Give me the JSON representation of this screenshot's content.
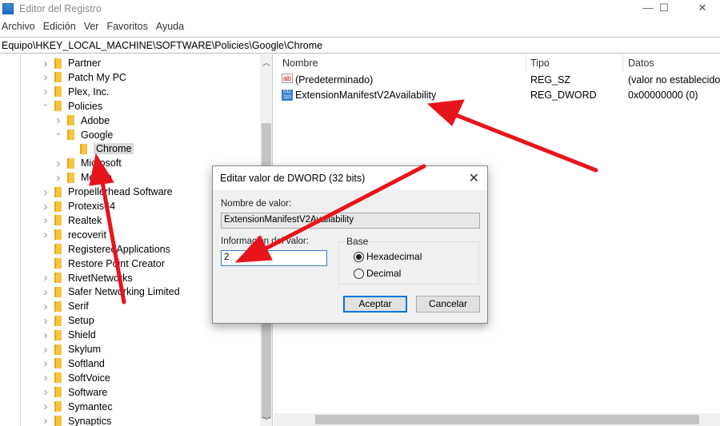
{
  "window": {
    "title": "Editor del Registro",
    "minimize": "—",
    "maximize": "☐",
    "close": "✕"
  },
  "menu": [
    "Archivo",
    "Edición",
    "Ver",
    "Favoritos",
    "Ayuda"
  ],
  "address": "Equipo\\HKEY_LOCAL_MACHINE\\SOFTWARE\\Policies\\Google\\Chrome",
  "tree": [
    {
      "label": "Partner",
      "level": 1,
      "state": "collapsed"
    },
    {
      "label": "Patch My PC",
      "level": 1,
      "state": "collapsed"
    },
    {
      "label": "Plex, Inc.",
      "level": 1,
      "state": "collapsed"
    },
    {
      "label": "Policies",
      "level": 1,
      "state": "expanded"
    },
    {
      "label": "Adobe",
      "level": 2,
      "state": "collapsed"
    },
    {
      "label": "Google",
      "level": 2,
      "state": "expanded"
    },
    {
      "label": "Chrome",
      "level": 3,
      "state": "selected"
    },
    {
      "label": "Microsoft",
      "level": 2,
      "state": "collapsed"
    },
    {
      "label": "Mozilla",
      "level": 2,
      "state": "collapsed"
    },
    {
      "label": "Propellerhead Software",
      "level": 1,
      "state": "collapsed"
    },
    {
      "label": "Protexis64",
      "level": 1,
      "state": "collapsed"
    },
    {
      "label": "Realtek",
      "level": 1,
      "state": "collapsed"
    },
    {
      "label": "recoverit",
      "level": 1,
      "state": "collapsed"
    },
    {
      "label": "RegisteredApplications",
      "level": 1,
      "state": "leaf"
    },
    {
      "label": "Restore Point Creator",
      "level": 1,
      "state": "leaf"
    },
    {
      "label": "RivetNetworks",
      "level": 1,
      "state": "collapsed"
    },
    {
      "label": "Safer Networking Limited",
      "level": 1,
      "state": "collapsed"
    },
    {
      "label": "Serif",
      "level": 1,
      "state": "collapsed"
    },
    {
      "label": "Setup",
      "level": 1,
      "state": "collapsed"
    },
    {
      "label": "Shield",
      "level": 1,
      "state": "collapsed"
    },
    {
      "label": "Skylum",
      "level": 1,
      "state": "collapsed"
    },
    {
      "label": "Softland",
      "level": 1,
      "state": "collapsed"
    },
    {
      "label": "SoftVoice",
      "level": 1,
      "state": "collapsed"
    },
    {
      "label": "Software",
      "level": 1,
      "state": "collapsed"
    },
    {
      "label": "Symantec",
      "level": 1,
      "state": "collapsed"
    },
    {
      "label": "Synaptics",
      "level": 1,
      "state": "collapsed"
    }
  ],
  "values": {
    "headers": {
      "name": "Nombre",
      "type": "Tipo",
      "data": "Datos"
    },
    "rows": [
      {
        "icon": "string-value-icon",
        "name": "(Predeterminado)",
        "type": "REG_SZ",
        "data": "(valor no establecido)"
      },
      {
        "icon": "dword-value-icon",
        "name": "ExtensionManifestV2Availability",
        "type": "REG_DWORD",
        "data": "0x00000000 (0)"
      }
    ]
  },
  "dialog": {
    "title": "Editar valor de DWORD (32 bits)",
    "close": "✕",
    "name_label": "Nombre de valor:",
    "name_value": "ExtensionManifestV2Availability",
    "data_label": "Información del valor:",
    "data_value": "2",
    "base_label": "Base",
    "base_options": [
      {
        "label": "Hexadecimal",
        "selected": true
      },
      {
        "label": "Decimal",
        "selected": false
      }
    ],
    "ok": "Aceptar",
    "cancel": "Cancelar"
  },
  "annotation_color": "#e8141c"
}
